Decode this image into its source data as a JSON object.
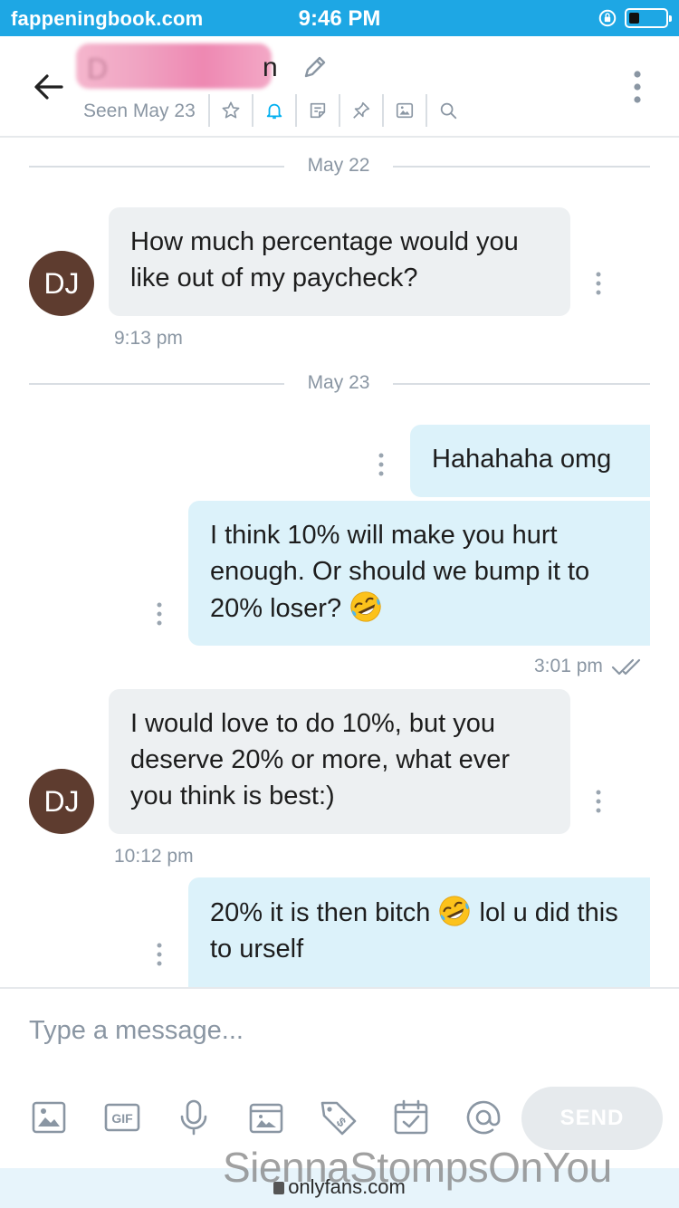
{
  "status_bar": {
    "watermark": "fappeningbook.com",
    "time": "9:46 PM",
    "battery_level": 0.3
  },
  "header": {
    "contact_name_visible_tail": "n",
    "seen_text": "Seen May 23",
    "icons": [
      "star-icon",
      "bell-icon",
      "note-icon",
      "pin-icon",
      "image-icon",
      "search-icon"
    ]
  },
  "chat": {
    "date_1": "May 22",
    "date_2": "May 23",
    "messages": [
      {
        "side": "in",
        "avatar": "DJ",
        "text": "How much percentage would you like out of my paycheck?",
        "time": "9:13 pm"
      },
      {
        "side": "out",
        "text": "Hahahaha omg"
      },
      {
        "side": "out",
        "text": "I think 10% will make you hurt enough. Or should we bump it to 20% loser?",
        "time": "3:01 pm"
      },
      {
        "side": "in",
        "avatar": "DJ",
        "text": "I would love to do 10%, but you deserve 20% or more, what ever you think is best:)",
        "time": "10:12 pm"
      },
      {
        "side": "out",
        "text_before_emoji": "20% it is then bitch",
        "text_after_emoji": "lol u did this to urself"
      }
    ]
  },
  "composer": {
    "placeholder": "Type a message...",
    "send_label": "SEND",
    "tools": [
      "image-icon",
      "gif-icon",
      "microphone-icon",
      "vault-icon",
      "price-tag-icon",
      "calendar-icon",
      "mention-icon"
    ]
  },
  "browser": {
    "url": "onlyfans.com",
    "overlay_watermark": "SiennaStompsOnYou"
  },
  "colors": {
    "status_bar": "#1ea7e4",
    "incoming_bubble": "#edf0f2",
    "outgoing_bubble": "#dcf2fa",
    "accent": "#00aff0",
    "avatar": "#5e3c2f"
  }
}
